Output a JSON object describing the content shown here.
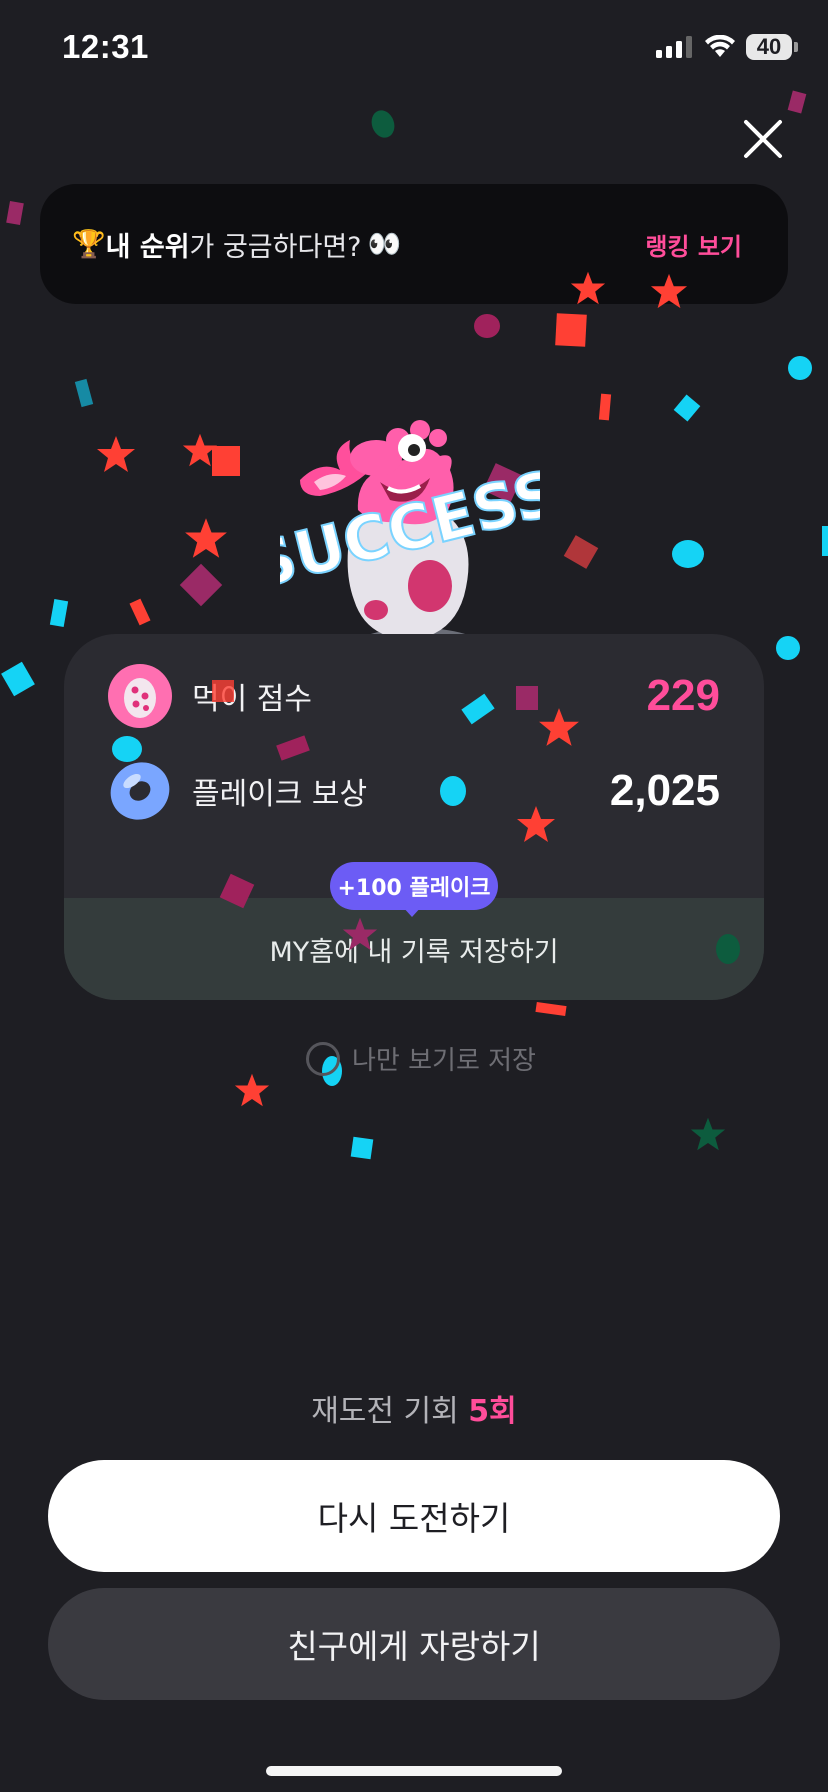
{
  "status_bar": {
    "time": "12:31",
    "battery": "40"
  },
  "rank_banner": {
    "trophy_emoji": "🏆",
    "bold_text": "내 순위",
    "rest_text": "가 궁금하다면?",
    "eyes_emoji": "👀",
    "link_label": "랭킹 보기"
  },
  "result": {
    "success_text": "SUCCESS",
    "score_label": "먹이 점수",
    "score_value": "229",
    "reward_label": "플레이크 보상",
    "reward_value": "2,025",
    "bonus_pill": "+100 플레이크",
    "save_label": "MY홈에 내 기록 저장하기"
  },
  "private_option": {
    "label": "나만 보기로 저장",
    "checked": false
  },
  "retry": {
    "prefix": "재도전 기회",
    "count": "5회"
  },
  "buttons": {
    "retry": "다시 도전하기",
    "share": "친구에게 자랑하기"
  },
  "colors": {
    "accent_pink": "#ff4d9a",
    "pill_purple": "#6c5cf5",
    "background": "#1e1e23"
  },
  "icons": [
    "signal-icon",
    "wifi-icon",
    "battery-icon",
    "close-icon",
    "trophy-icon",
    "eyes-icon",
    "egg-icon",
    "flake-icon",
    "radio-icon"
  ]
}
